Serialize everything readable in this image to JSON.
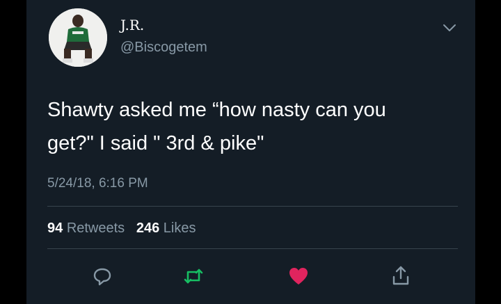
{
  "user": {
    "display_name": "J.R.",
    "handle": "@Biscogetem"
  },
  "tweet": {
    "text_line1": "Shawty asked me “how nasty can you",
    "text_line2": "get?\" I said \" 3rd & pike\"",
    "timestamp": "5/24/18, 6:16 PM"
  },
  "stats": {
    "retweets_count": "94",
    "retweets_label": "Retweets",
    "likes_count": "246",
    "likes_label": "Likes"
  },
  "icons": {
    "reply": "reply-icon",
    "retweet": "retweet-icon",
    "like": "heart-icon",
    "share": "share-icon",
    "menu": "chevron-down-icon"
  },
  "colors": {
    "background": "#141d26",
    "text": "#ffffff",
    "secondary_text": "#8899a6",
    "retweet_active": "#17bf63",
    "like_active": "#e0245e"
  }
}
